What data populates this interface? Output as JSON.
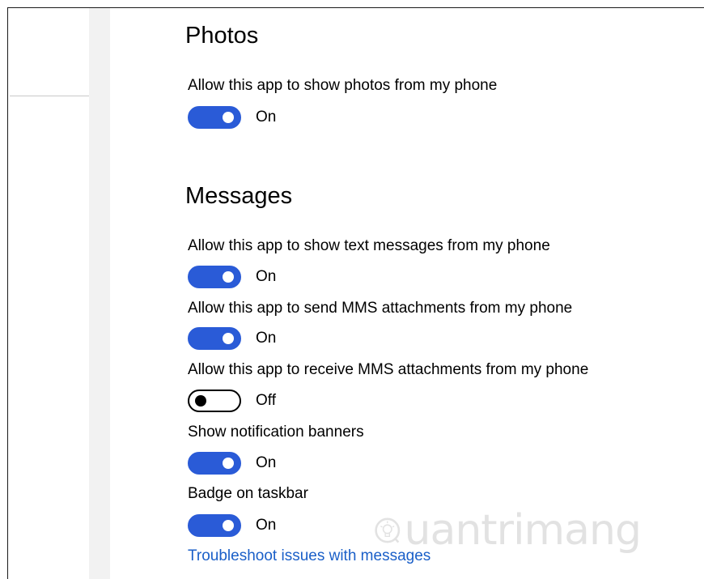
{
  "photos": {
    "title": "Photos",
    "settings": [
      {
        "label": "Allow this app to show photos from my phone",
        "on": true,
        "state_text": "On"
      }
    ]
  },
  "messages": {
    "title": "Messages",
    "settings": [
      {
        "label": "Allow this app to show text messages from my phone",
        "on": true,
        "state_text": "On"
      },
      {
        "label": "Allow this app to send MMS attachments from my phone",
        "on": true,
        "state_text": "On"
      },
      {
        "label": "Allow this app to receive MMS attachments from my phone",
        "on": false,
        "state_text": "Off"
      },
      {
        "label": "Show notification banners",
        "on": true,
        "state_text": "On"
      },
      {
        "label": "Badge on taskbar",
        "on": true,
        "state_text": "On"
      }
    ],
    "troubleshoot_link": "Troubleshoot issues with messages"
  },
  "watermark": {
    "text": "uantrimang",
    "icon": "lightbulb-icon"
  },
  "colors": {
    "accent": "#2a5bd7",
    "link": "#1a5fc8",
    "nav_pane": "#f2f2f2"
  }
}
